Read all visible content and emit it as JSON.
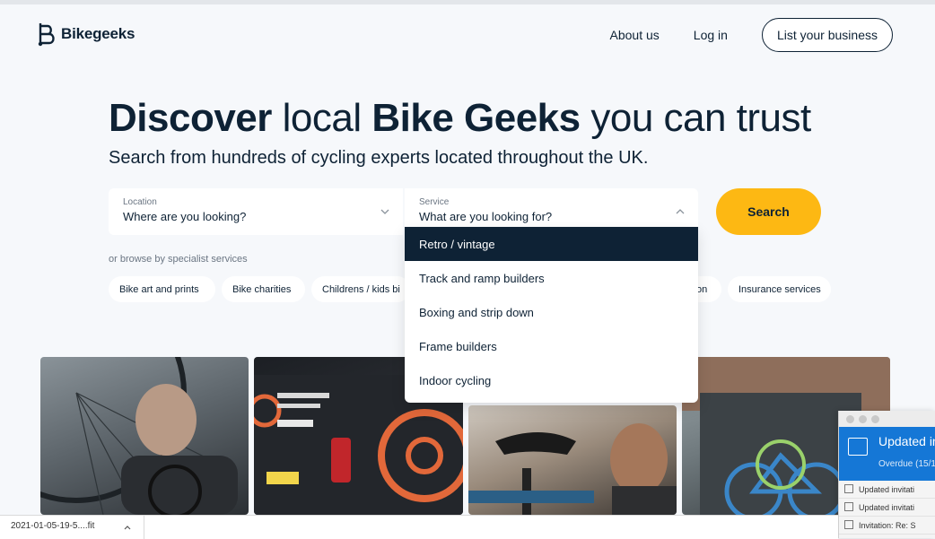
{
  "header": {
    "logo_text": "Bikegeeks",
    "nav": {
      "about": "About us",
      "login": "Log in",
      "list_business": "List your business"
    }
  },
  "hero": {
    "title_b1": "Discover",
    "title_r1": " local ",
    "title_b2": "Bike Geeks",
    "title_r2": " you can trust",
    "subtitle": "Search from hundreds of cycling experts located throughout the UK."
  },
  "search": {
    "location": {
      "label": "Location",
      "value": "Where are you looking?"
    },
    "service": {
      "label": "Service",
      "value": "What are you looking for?"
    },
    "button": "Search"
  },
  "dropdown": {
    "items": [
      "Retro / vintage",
      "Track and ramp builders",
      "Boxing and strip down",
      "Frame builders",
      "Indoor cycling"
    ],
    "active_index": 0
  },
  "browse": {
    "label": "or browse by specialist services",
    "chips": [
      "Bike art and prints",
      "Bike charities",
      "Childrens / kids bi",
      "on",
      "Insurance services"
    ]
  },
  "notification": {
    "title": "Updated inv",
    "subtitle": "Overdue (15/1",
    "rows": [
      "Updated invitati",
      "Updated invitati",
      "Invitation: Re: S"
    ]
  },
  "download": {
    "filename": "2021-01-05-19-5....fit"
  },
  "colors": {
    "navy": "#0e2235",
    "accent_yellow": "#fdb813",
    "notification_blue": "#1577d6"
  }
}
